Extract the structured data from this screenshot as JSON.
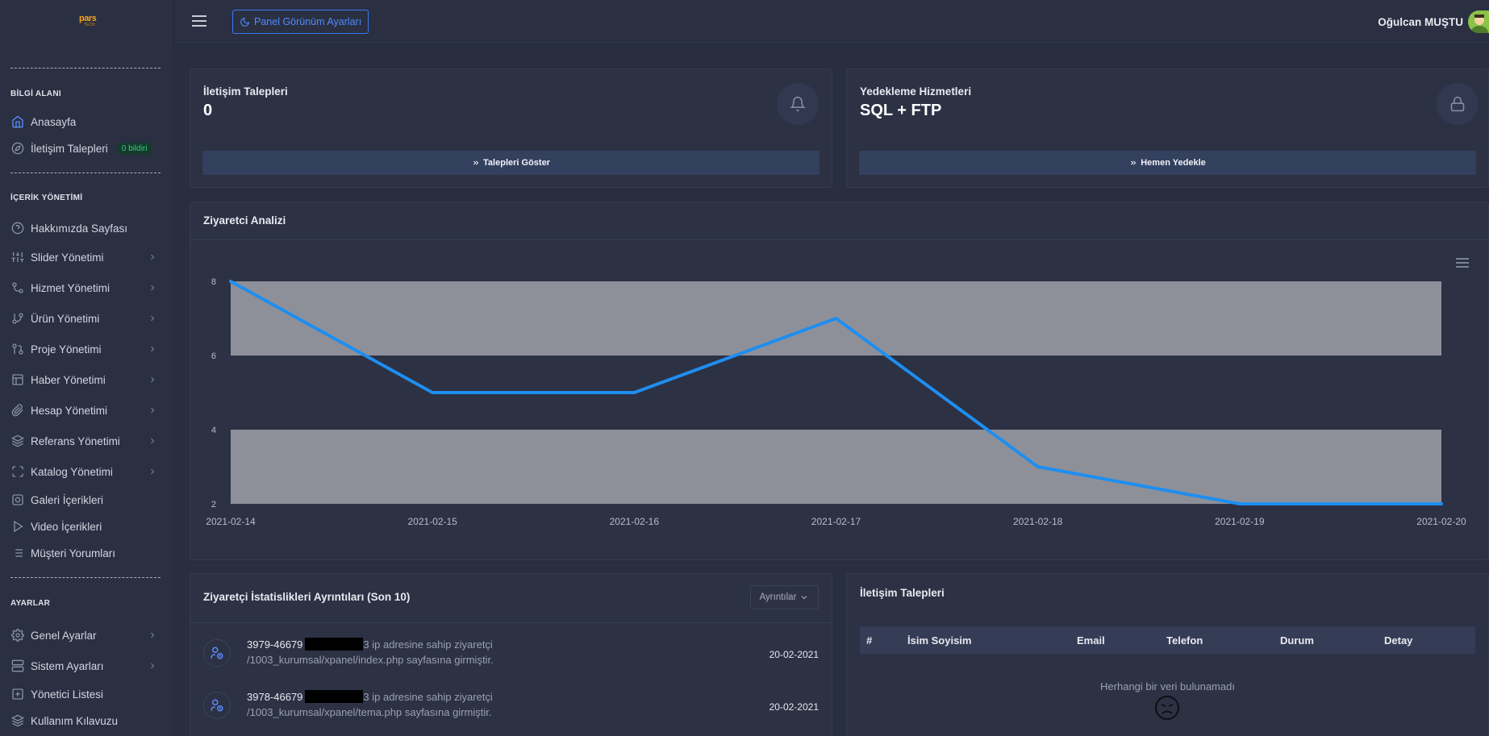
{
  "brand": {
    "logo_text": "pars",
    "logo_sub": "TECH"
  },
  "topbar": {
    "theme_button": "Panel Görünüm Ayarları",
    "user_name": "Oğulcan MUŞTU"
  },
  "sidebar": {
    "sections": [
      {
        "heading": "BİLGİ ALANI"
      },
      {
        "heading": "İÇERİK YÖNETİMİ"
      },
      {
        "heading": "AYARLAR"
      }
    ],
    "items": [
      {
        "label": "Anasayfa",
        "icon": "home-icon"
      },
      {
        "label": "İletişim Talepleri",
        "icon": "compass-icon",
        "badge": "0 bildiri"
      },
      {
        "label": "Hakkımızda Sayfası",
        "icon": "help-circle-icon"
      },
      {
        "label": "Slider Yönetimi",
        "icon": "sliders-icon"
      },
      {
        "label": "Hizmet Yönetimi",
        "icon": "git-commit-icon"
      },
      {
        "label": "Ürün Yönetimi",
        "icon": "git-branch-icon"
      },
      {
        "label": "Proje Yönetimi",
        "icon": "git-pull-request-icon"
      },
      {
        "label": "Haber Yönetimi",
        "icon": "layout-icon"
      },
      {
        "label": "Hesap Yönetimi",
        "icon": "paperclip-icon"
      },
      {
        "label": "Referans Yönetimi",
        "icon": "layers-icon"
      },
      {
        "label": "Katalog Yönetimi",
        "icon": "maximize-icon"
      },
      {
        "label": "Galeri İçerikleri",
        "icon": "disc-icon"
      },
      {
        "label": "Video İçerikleri",
        "icon": "play-icon"
      },
      {
        "label": "Müşteri Yorumları",
        "icon": "list-icon"
      },
      {
        "label": "Genel Ayarlar",
        "icon": "settings-icon"
      },
      {
        "label": "Sistem Ayarları",
        "icon": "server-icon"
      },
      {
        "label": "Yönetici Listesi",
        "icon": "plus-square-icon"
      },
      {
        "label": "Kullanım Kılavuzu",
        "icon": "layers-icon"
      }
    ]
  },
  "cards": {
    "contact": {
      "title": "İletişim Talepleri",
      "value": "0",
      "button": "Talepleri Göster"
    },
    "backup": {
      "title": "Yedekleme Hizmetleri",
      "value": "SQL + FTP",
      "button": "Hemen Yedekle"
    }
  },
  "chart_data": {
    "type": "line",
    "title": "Ziyaretci Analizi",
    "x": [
      "2021-02-14",
      "2021-02-15",
      "2021-02-16",
      "2021-02-17",
      "2021-02-18",
      "2021-02-19",
      "2021-02-20"
    ],
    "series": [
      {
        "values": [
          8,
          5,
          5,
          7,
          3,
          2,
          2
        ]
      }
    ],
    "ylim": [
      2,
      8
    ],
    "yticks": [
      8,
      6,
      4,
      2
    ],
    "line_color": "#1e8ef0",
    "band_color": "#8e9099"
  },
  "visits": {
    "title": "Ziyaretçi İstatislikleri Ayrıntıları (Son 10)",
    "detail_button": "Ayrıntılar",
    "rows": [
      {
        "id": "3979-46679",
        "text1": "3 ip adresine sahip ziyaretçi",
        "text2": "/1003_kurumsal/xpanel/index.php sayfasına girmiştir.",
        "date": "20-02-2021"
      },
      {
        "id": "3978-46679",
        "text1": "3 ip adresine sahip ziyaretçi",
        "text2": "/1003_kurumsal/xpanel/tema.php sayfasına girmiştir.",
        "date": "20-02-2021"
      }
    ]
  },
  "contacts_table": {
    "title": "İletişim Talepleri",
    "columns": [
      "#",
      "İsim Soyisim",
      "Email",
      "Telefon",
      "Durum",
      "Detay"
    ],
    "empty_message": "Herhangi bir veri bulunamadı"
  }
}
